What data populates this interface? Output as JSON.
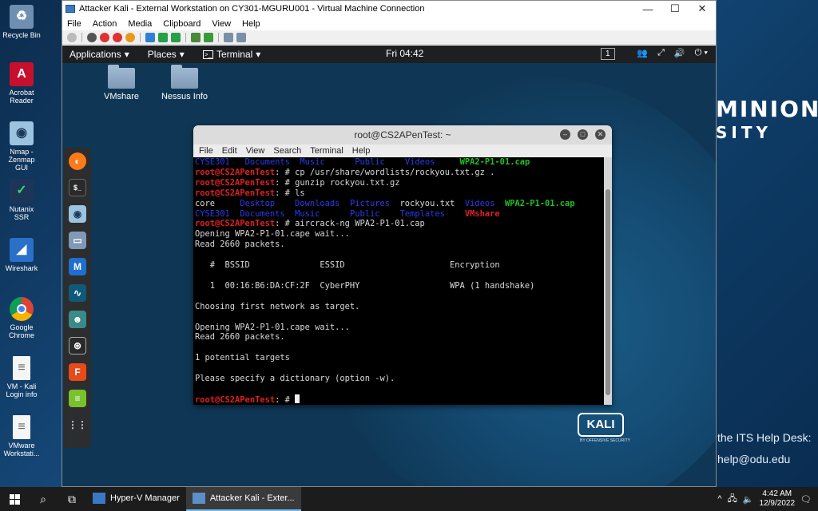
{
  "host": {
    "desktop_icons": [
      {
        "label": "Recycle Bin",
        "icon": "recycle-bin-icon"
      },
      {
        "label": "Acrobat Reader",
        "icon": "acrobat-icon"
      },
      {
        "label": "Nmap - Zenmap GUI",
        "icon": "nmap-eye-icon"
      },
      {
        "label": "Nutanix SSR",
        "icon": "nutanix-icon"
      },
      {
        "label": "Wireshark",
        "icon": "wireshark-fin-icon"
      },
      {
        "label": "Google Chrome",
        "icon": "chrome-icon"
      },
      {
        "label": "VM - Kali Login info",
        "icon": "document-icon"
      },
      {
        "label": "VMware Workstati...",
        "icon": "document-icon"
      }
    ],
    "brand_line1": "MINION",
    "brand_line2": "SITY",
    "help_text1": "the ITS Help Desk:",
    "help_text2": "help@odu.edu"
  },
  "vm": {
    "title": "Attacker Kali - External Workstation on CY301-MGURU001 - Virtual Machine Connection",
    "menu": [
      "File",
      "Action",
      "Media",
      "Clipboard",
      "View",
      "Help"
    ]
  },
  "kali": {
    "apps_menu": "Applications",
    "places_menu": "Places",
    "terminal_menu": "Terminal",
    "clock": "Fri 04:42",
    "workspace": "1",
    "desktop_icons": [
      {
        "label": "VMshare"
      },
      {
        "label": "Nessus Info"
      }
    ],
    "logo_text": "KALI",
    "logo_sub": "BY OFFENSIVE SECURITY"
  },
  "terminal": {
    "title": "root@CS2APenTest: ~",
    "menu": [
      "File",
      "Edit",
      "View",
      "Search",
      "Terminal",
      "Help"
    ],
    "prompt": "root@CS2APenTest",
    "lines": {
      "l1_a": "CYSE301",
      "l1_b": "Documents",
      "l1_c": "Music",
      "l1_d": "Public",
      "l1_e": "Videos",
      "l1_f": "WPA2-P1-01.cap",
      "cmd1": "cp /usr/share/wordlists/rockyou.txt.gz .",
      "cmd2": "gunzip rockyou.txt.gz",
      "cmd3": "ls",
      "l5_a": "core",
      "l5_b": "Desktop",
      "l5_c": "Downloads",
      "l5_d": "Pictures",
      "l5_e": "rockyou.txt",
      "l5_f": "Videos",
      "l5_g": "WPA2-P1-01.cap",
      "l6_a": "CYSE301",
      "l6_b": "Documents",
      "l6_c": "Music",
      "l6_d": "Public",
      "l6_e": "Templates",
      "l6_f": "VMshare",
      "cmd4": "aircrack-ng WPA2-P1-01.cap",
      "out1": "Opening WPA2-P1-01.cape wait...",
      "out2": "Read 2660 packets.",
      "hdr": "   #  BSSID              ESSID                     Encryption",
      "row": "   1  00:16:B6:DA:CF:2F  CyberPHY                  WPA (1 handshake)",
      "out3": "Choosing first network as target.",
      "out4": "Opening WPA2-P1-01.cape wait...",
      "out5": "Read 2660 packets.",
      "out6": "1 potential targets",
      "out7": "Please specify a dictionary (option -w)."
    }
  },
  "taskbar": {
    "apps": [
      {
        "label": "Hyper-V Manager",
        "active": false
      },
      {
        "label": "Attacker Kali - Exter...",
        "active": true
      }
    ],
    "time": "4:42 AM",
    "date": "12/9/2022"
  }
}
